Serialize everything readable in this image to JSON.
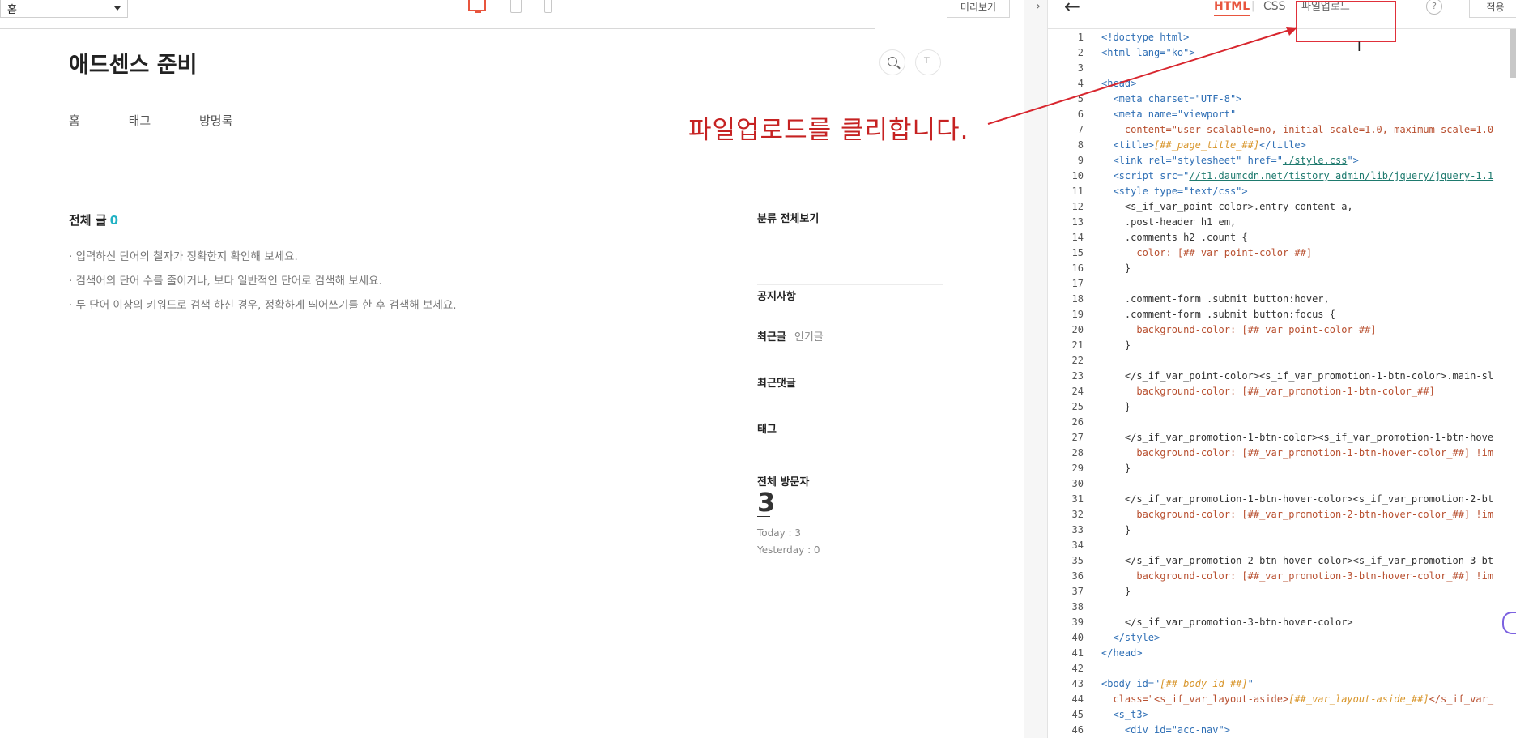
{
  "toolbar": {
    "page_select": "홈",
    "preview_label": "미리보기"
  },
  "blog": {
    "title": "애드센스 준비",
    "nav": [
      "홈",
      "태그",
      "방명록"
    ],
    "main": {
      "count_label": "전체 글",
      "count_value": "0",
      "tips": [
        "입력하신 단어의 철자가 정확한지 확인해 보세요.",
        "검색어의 단어 수를 줄이거나, 보다 일반적인 단어로 검색해 보세요.",
        "두 단어 이상의 키워드로 검색 하신 경우, 정확하게 띄어쓰기를 한 후 검색해 보세요."
      ]
    },
    "sidebar": {
      "category": "분류 전체보기",
      "notice": "공지사항",
      "recent": "최근글",
      "popular": "인기글",
      "recent_comments": "최근댓글",
      "tags": "태그",
      "visitors_label": "전체 방문자",
      "visitors_total": "3",
      "today": "Today : 3",
      "yesterday": "Yesterday : 0"
    }
  },
  "annotation": {
    "text": "파일업로드를 클리합니다.",
    "color": "#c62222"
  },
  "editor": {
    "tabs": {
      "html": "HTML",
      "css": "CSS",
      "upload": "파일업로드"
    },
    "help": "?",
    "apply": "적용",
    "accent": "#e8553e",
    "line_numbers": [
      "1",
      "2",
      "3",
      "4",
      "5",
      "6",
      "7",
      "8",
      "9",
      "10",
      "11",
      "12",
      "13",
      "14",
      "15",
      "16",
      "17",
      "18",
      "19",
      "20",
      "21",
      "22",
      "23",
      "24",
      "25",
      "26",
      "27",
      "28",
      "29",
      "30",
      "31",
      "32",
      "33",
      "34",
      "35",
      "36",
      "37",
      "38",
      "39",
      "40",
      "41",
      "42",
      "43",
      "44",
      "45",
      "46"
    ],
    "code": {
      "l1": "<!doctype html>",
      "l2": "<html lang=\"ko\">",
      "l4": "<head>",
      "l5": "  <meta charset=\"UTF-8\">",
      "l6": "  <meta name=\"viewport\"",
      "l7": "    content=\"user-scalable=no, initial-scale=1.0, maximum-scale=1.0",
      "l8a": "  <title>",
      "l8b": "[##_page_title_##]",
      "l8c": "</title>",
      "l9a": "  <link rel=\"stylesheet\" href=\"",
      "l9b": "./style.css",
      "l9c": "\">",
      "l10a": "  <script src=\"",
      "l10b": "//t1.daumcdn.net/tistory_admin/lib/jquery/jquery-1.1",
      "l11": "  <style type=\"text/css\">",
      "l12": "    <s_if_var_point-color>.entry-content a,",
      "l13": "    .post-header h1 em,",
      "l14": "    .comments h2 .count {",
      "l15": "      color: [##_var_point-color_##]",
      "l16": "    }",
      "l18": "    .comment-form .submit button:hover,",
      "l19": "    .comment-form .submit button:focus {",
      "l20": "      background-color: [##_var_point-color_##]",
      "l21": "    }",
      "l23": "    </s_if_var_point-color><s_if_var_promotion-1-btn-color>.main-sl",
      "l24": "      background-color: [##_var_promotion-1-btn-color_##]",
      "l25": "    }",
      "l27": "    </s_if_var_promotion-1-btn-color><s_if_var_promotion-1-btn-hove",
      "l28": "      background-color: [##_var_promotion-1-btn-hover-color_##] !im",
      "l29": "    }",
      "l31": "    </s_if_var_promotion-1-btn-hover-color><s_if_var_promotion-2-bt",
      "l32": "      background-color: [##_var_promotion-2-btn-hover-color_##] !im",
      "l33": "    }",
      "l35": "    </s_if_var_promotion-2-btn-hover-color><s_if_var_promotion-3-bt",
      "l36": "      background-color: [##_var_promotion-3-btn-hover-color_##] !im",
      "l37": "    }",
      "l39": "    </s_if_var_promotion-3-btn-hover-color>",
      "l40": "  </style>",
      "l41": "</head>",
      "l43a": "<body id=\"",
      "l43b": "[##_body_id_##]",
      "l43c": "\"",
      "l44a": "  class=\"<s_if_var_layout-aside>",
      "l44b": "[##_var_layout-aside_##]",
      "l44c": "</s_if_var_",
      "l45": "  <s_t3>",
      "l46": "    <div id=\"acc-nav\">"
    }
  }
}
